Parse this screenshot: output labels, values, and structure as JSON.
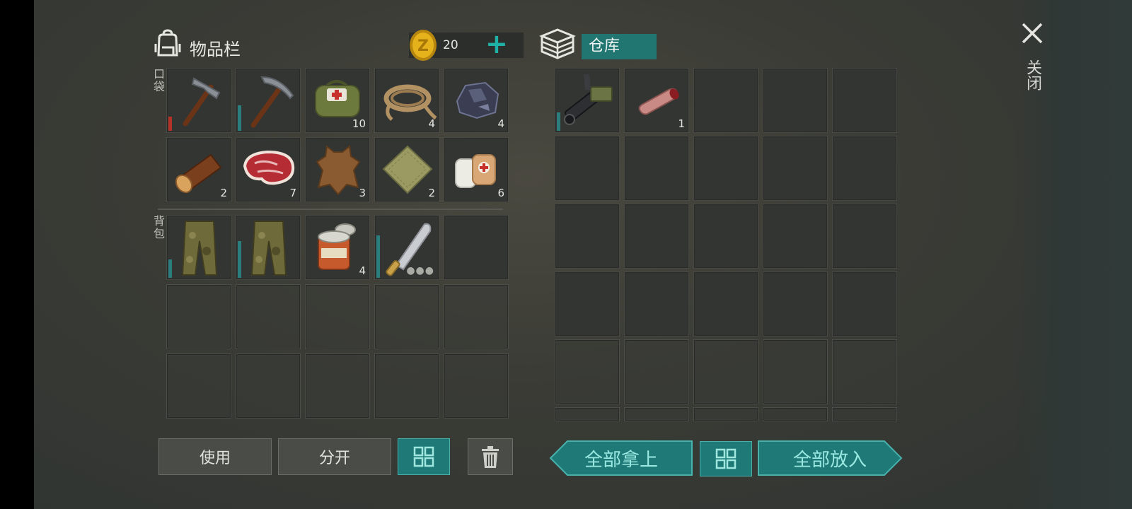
{
  "inventory": {
    "title": "物品栏",
    "coins": "20",
    "plus_label": "+",
    "pocket_label": "口袋",
    "backpack_label": "背包",
    "pocket_items": [
      {
        "name": "hammer-item",
        "count": ""
      },
      {
        "name": "pickaxe-item",
        "count": ""
      },
      {
        "name": "medkit-bag-item",
        "count": "10"
      },
      {
        "name": "rope-item",
        "count": "4"
      },
      {
        "name": "coal-ore-item",
        "count": "4"
      },
      {
        "name": "log-item",
        "count": "2"
      },
      {
        "name": "raw-meat-item",
        "count": "7"
      },
      {
        "name": "animal-hide-item",
        "count": "3"
      },
      {
        "name": "cloth-item",
        "count": "2"
      },
      {
        "name": "bandage-item",
        "count": "6"
      }
    ],
    "backpack_items": [
      {
        "name": "camo-pants-item",
        "count": ""
      },
      {
        "name": "camo-pants-item-2",
        "count": ""
      },
      {
        "name": "canned-food-item",
        "count": "4"
      },
      {
        "name": "machete-item",
        "count": ""
      }
    ]
  },
  "storage": {
    "title": "仓库",
    "items": [
      {
        "name": "minigun-item",
        "count": ""
      },
      {
        "name": "finger-item",
        "count": "1"
      }
    ]
  },
  "buttons": {
    "use": "使用",
    "split": "分开",
    "take_all": "全部拿上",
    "put_all": "全部放入"
  },
  "close_label": "关闭",
  "icons": {
    "backpack": "backpack-icon",
    "coin": "coin-icon",
    "storage": "storage-crate-icon",
    "sort": "sort-grid-icon",
    "trash": "trash-icon",
    "close": "close-icon"
  },
  "colors": {
    "accent_teal": "#1f7a77",
    "durability_teal": "#2a7f7e",
    "durability_red": "#b53229",
    "coin_gold": "#e5b21b"
  }
}
